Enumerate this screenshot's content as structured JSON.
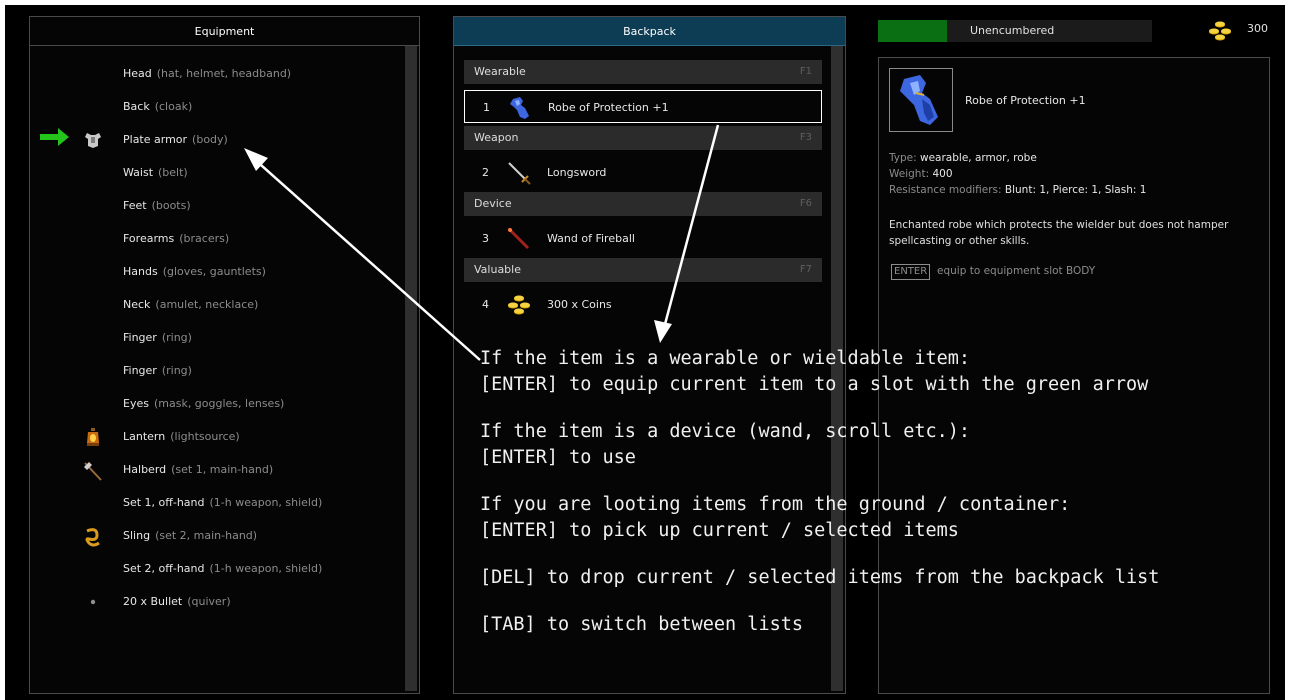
{
  "equipment": {
    "title": "Equipment",
    "slots": [
      {
        "label": "Head",
        "hint": "(hat, helmet, headband)",
        "icon": ""
      },
      {
        "label": "Back",
        "hint": "(cloak)",
        "icon": ""
      },
      {
        "label": "Plate armor",
        "hint": "(body)",
        "icon": "plate-armor-icon",
        "target": true
      },
      {
        "label": "Waist",
        "hint": "(belt)",
        "icon": ""
      },
      {
        "label": "Feet",
        "hint": "(boots)",
        "icon": ""
      },
      {
        "label": "Forearms",
        "hint": "(bracers)",
        "icon": ""
      },
      {
        "label": "Hands",
        "hint": "(gloves, gauntlets)",
        "icon": ""
      },
      {
        "label": "Neck",
        "hint": "(amulet, necklace)",
        "icon": ""
      },
      {
        "label": "Finger",
        "hint": "(ring)",
        "icon": ""
      },
      {
        "label": "Finger",
        "hint": "(ring)",
        "icon": ""
      },
      {
        "label": "Eyes",
        "hint": "(mask, goggles, lenses)",
        "icon": ""
      },
      {
        "label": "Lantern",
        "hint": "(lightsource)",
        "icon": "lantern-icon"
      },
      {
        "label": "Halberd",
        "hint": "(set 1, main-hand)",
        "icon": "halberd-icon"
      },
      {
        "label": "Set 1, off-hand",
        "hint": "(1-h weapon, shield)",
        "icon": ""
      },
      {
        "label": "Sling",
        "hint": "(set 2, main-hand)",
        "icon": "sling-icon"
      },
      {
        "label": "Set 2, off-hand",
        "hint": "(1-h weapon, shield)",
        "icon": ""
      },
      {
        "label": "20 x Bullet",
        "hint": "(quiver)",
        "icon": "bullet-icon"
      }
    ]
  },
  "backpack": {
    "title": "Backpack",
    "groups": [
      {
        "name": "Wearable",
        "key": "F1",
        "items": [
          {
            "num": "1",
            "name": "Robe of Protection +1",
            "icon": "robe-icon",
            "selected": true
          }
        ]
      },
      {
        "name": "Weapon",
        "key": "F3",
        "items": [
          {
            "num": "2",
            "name": "Longsword",
            "icon": "longsword-icon"
          }
        ]
      },
      {
        "name": "Device",
        "key": "F6",
        "items": [
          {
            "num": "3",
            "name": "Wand of Fireball",
            "icon": "wand-icon"
          }
        ]
      },
      {
        "name": "Valuable",
        "key": "F7",
        "items": [
          {
            "num": "4",
            "name": "300 x Coins",
            "icon": "coins-icon"
          }
        ]
      }
    ]
  },
  "status": {
    "encumbrance_label": "Unencumbered",
    "encumbrance_fraction": 0.25,
    "bar_color": "#0a6e12",
    "gold": "300"
  },
  "details": {
    "name": "Robe of Protection +1",
    "type_label": "Type:",
    "type_value": "wearable, armor, robe",
    "weight_label": "Weight:",
    "weight_value": "400",
    "resist_label": "Resistance modifiers:",
    "resist_value": "Blunt: 1, Pierce: 1, Slash: 1",
    "description": "Enchanted robe which protects the wielder but does not hamper spellcasting or other skills.",
    "enter_key": "ENTER",
    "enter_action": "equip to equipment slot BODY"
  },
  "help": {
    "lines": [
      "If the item is a wearable or wieldable item:",
      "[ENTER] to equip current item to a slot with the green arrow",
      "",
      "If the item is a device (wand, scroll etc.):",
      "[ENTER] to use",
      "",
      "If you are looting items from the ground / container:",
      "[ENTER] to pick up current / selected items",
      "",
      "[DEL] to drop current / selected items from the backpack list",
      "",
      "[TAB] to switch between lists"
    ]
  }
}
